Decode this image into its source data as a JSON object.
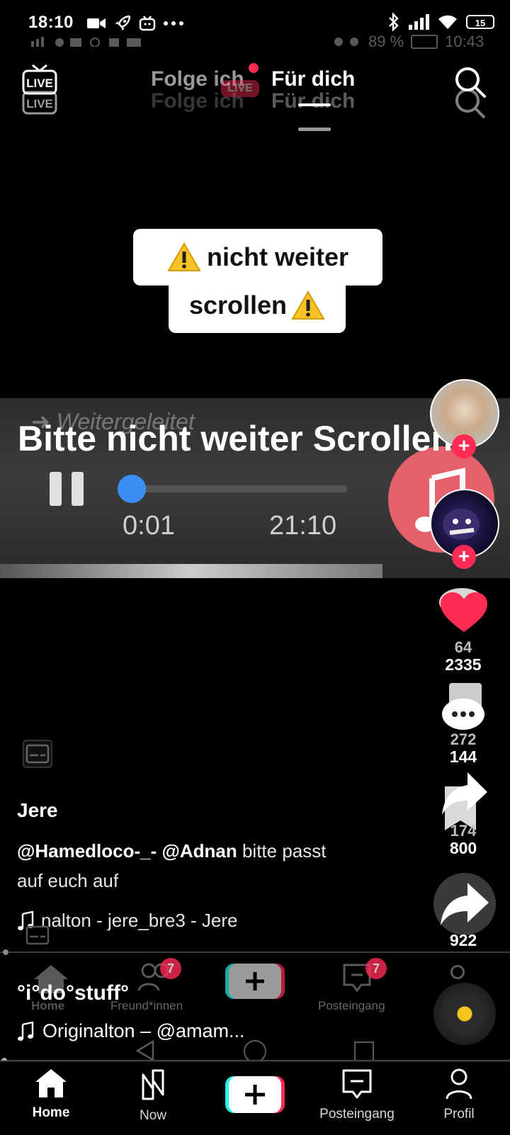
{
  "status_bar": {
    "time": "18:10",
    "battery": "15"
  },
  "ghost_status": {
    "battery_pct": "89 %",
    "time": "10:43"
  },
  "top_nav": {
    "tab_following": "Folge ich",
    "tab_for_you": "Für dich",
    "live_label": "LIVE",
    "ghost_live_badge": "LIVE"
  },
  "video": {
    "warning_line1": "nicht weiter",
    "warning_line2": "scrollen",
    "forwarded_text": "Weitergeleitet",
    "caption": "Bitte nicht weiter Scrollen",
    "time_current": "0:01",
    "time_total": "21:10",
    "progress_fraction": 0.02
  },
  "right_rail": {
    "like_count": "2335",
    "ghost_like_count": "64",
    "comment_count": "144",
    "ghost_comment_count": "272",
    "share_count": "800",
    "ghost_share_count": "174",
    "forward_count": "922"
  },
  "post": {
    "author": "Jere",
    "mention1": "@Hamedloco-_-",
    "mention2": "@Adnan",
    "desc_text1": " bitte passt",
    "desc_text2": "auf euch auf",
    "sound": "nalton - jere_bre3 - Jere"
  },
  "inner_post": {
    "author": "°i°do°stuff°",
    "sound": "Originalton – @amam..."
  },
  "ghost_nav": {
    "home": "Home",
    "friends": "Freund*innen",
    "friends_badge": "7",
    "inbox": "Posteingang",
    "inbox_badge": "7"
  },
  "bottom_nav": {
    "home": "Home",
    "now": "Now",
    "inbox": "Posteingang",
    "profile": "Profil"
  },
  "colors": {
    "accent_red": "#fe2c55",
    "accent_cyan": "#25f4ee",
    "seek_blue": "#3a8ef5"
  }
}
